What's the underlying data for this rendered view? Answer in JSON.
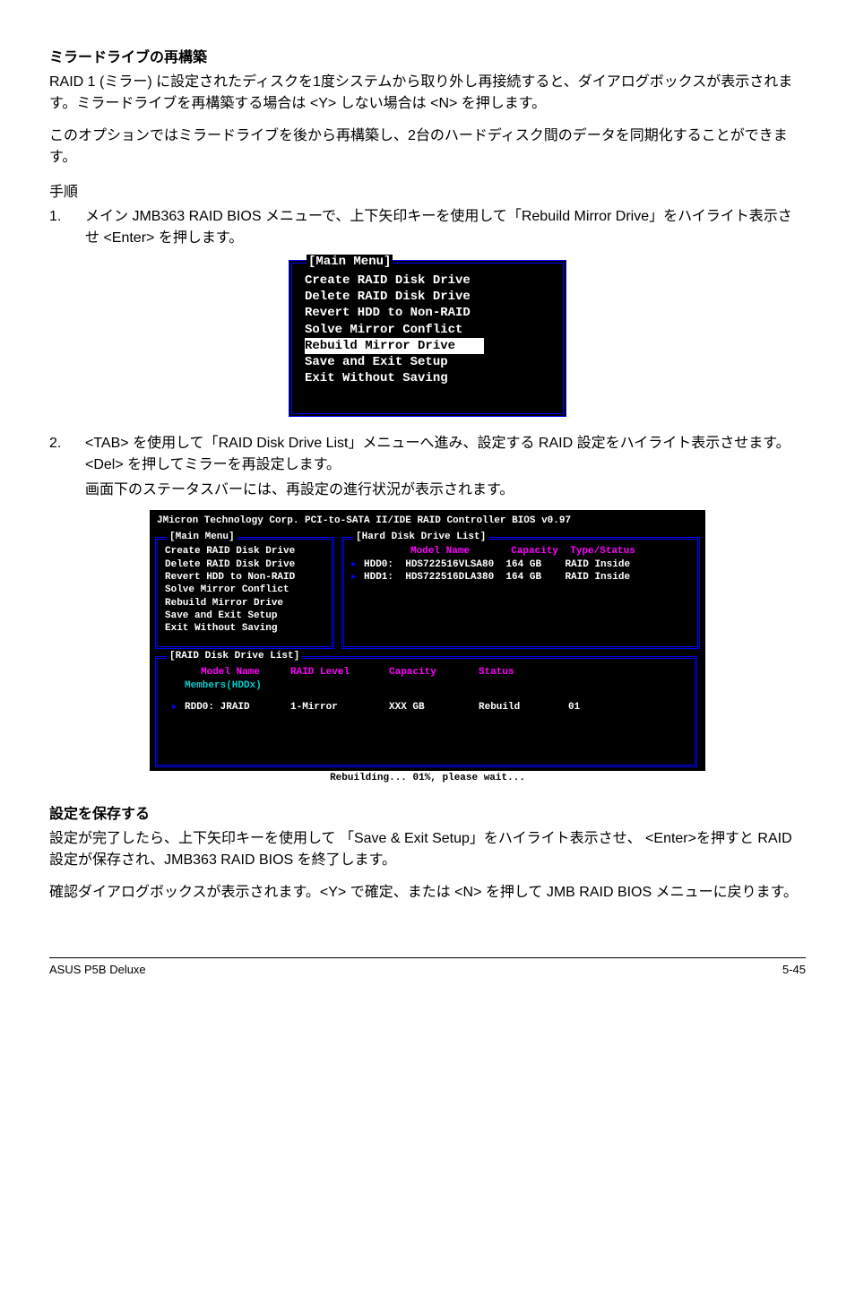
{
  "section1": {
    "heading": "ミラードライブの再構築",
    "para1": "RAID 1 (ミラー) に設定されたディスクを1度システムから取り外し再接続すると、ダイアログボックスが表示されます。ミラードライブを再構築する場合は <Y> しない場合は <N> を押します。",
    "para2": "このオプションではミラードライブを後から再構築し、2台のハードディスク間のデータを同期化することができます。",
    "steps_label": "手順",
    "step1_num": "1.",
    "step1": "メイン JMB363 RAID BIOS メニューで、上下矢印キーを使用して「Rebuild Mirror Drive」をハイライト表示させ <Enter> を押します。",
    "step2_num": "2.",
    "step2a": "<TAB> を使用して「RAID Disk Drive List」メニューへ進み、設定する RAID 設定をハイライト表示させます。<Del> を押してミラーを再設定します。",
    "step2b": "画面下のステータスバーには、再設定の進行状況が表示されます。"
  },
  "bios_menu": {
    "title": "[Main Menu]",
    "items": [
      "Create RAID Disk Drive",
      "Delete RAID Disk Drive",
      "Revert HDD to Non-RAID",
      "Solve Mirror Conflict",
      "Rebuild Mirror Drive",
      "Save and Exit Setup",
      "Exit Without Saving"
    ],
    "selected_index": 4
  },
  "bios_screen": {
    "header": "JMicron Technology Corp. PCI-to-SATA II/IDE RAID Controller BIOS v0.97",
    "main_menu_title": "[Main Menu]",
    "main_menu_items": [
      "Create RAID Disk Drive",
      "Delete RAID Disk Drive",
      "Revert HDD to Non-RAID",
      "Solve Mirror Conflict",
      "Rebuild Mirror Drive",
      "Save and Exit Setup",
      "Exit Without Saving"
    ],
    "hdd_list_title": "[Hard Disk Drive List]",
    "hdd_headers": {
      "model": "Model Name",
      "capacity": "Capacity",
      "type": "Type/Status"
    },
    "hdd_rows": [
      {
        "id": "HDD0:",
        "model": "HDS722516VLSA80",
        "capacity": "164 GB",
        "type": "RAID Inside"
      },
      {
        "id": "HDD1:",
        "model": "HDS722516DLA380",
        "capacity": "164 GB",
        "type": "RAID Inside"
      }
    ],
    "raid_list_title": "[RAID Disk Drive List]",
    "raid_headers": {
      "model": "Model Name",
      "level": "RAID Level",
      "capacity": "Capacity",
      "status": "Status"
    },
    "members_label": "Members(HDDx)",
    "raid_rows": [
      {
        "id": "RDD0:",
        "name": "JRAID",
        "level": "1-Mirror",
        "capacity": "XXX GB",
        "status": "Rebuild",
        "members": "01"
      }
    ],
    "status_bar": "Rebuilding... 01%, please wait..."
  },
  "section2": {
    "heading": "設定を保存する",
    "para1": "設定が完了したら、上下矢印キーを使用して 「Save & Exit Setup」をハイライト表示させ、 <Enter>を押すと RAID 設定が保存され、JMB363 RAID BIOS を終了します。",
    "para2": "確認ダイアログボックスが表示されます。<Y> で確定、または <N> を押して JMB RAID BIOS メニューに戻ります。"
  },
  "footer": {
    "left": "ASUS P5B Deluxe",
    "right": "5-45"
  }
}
